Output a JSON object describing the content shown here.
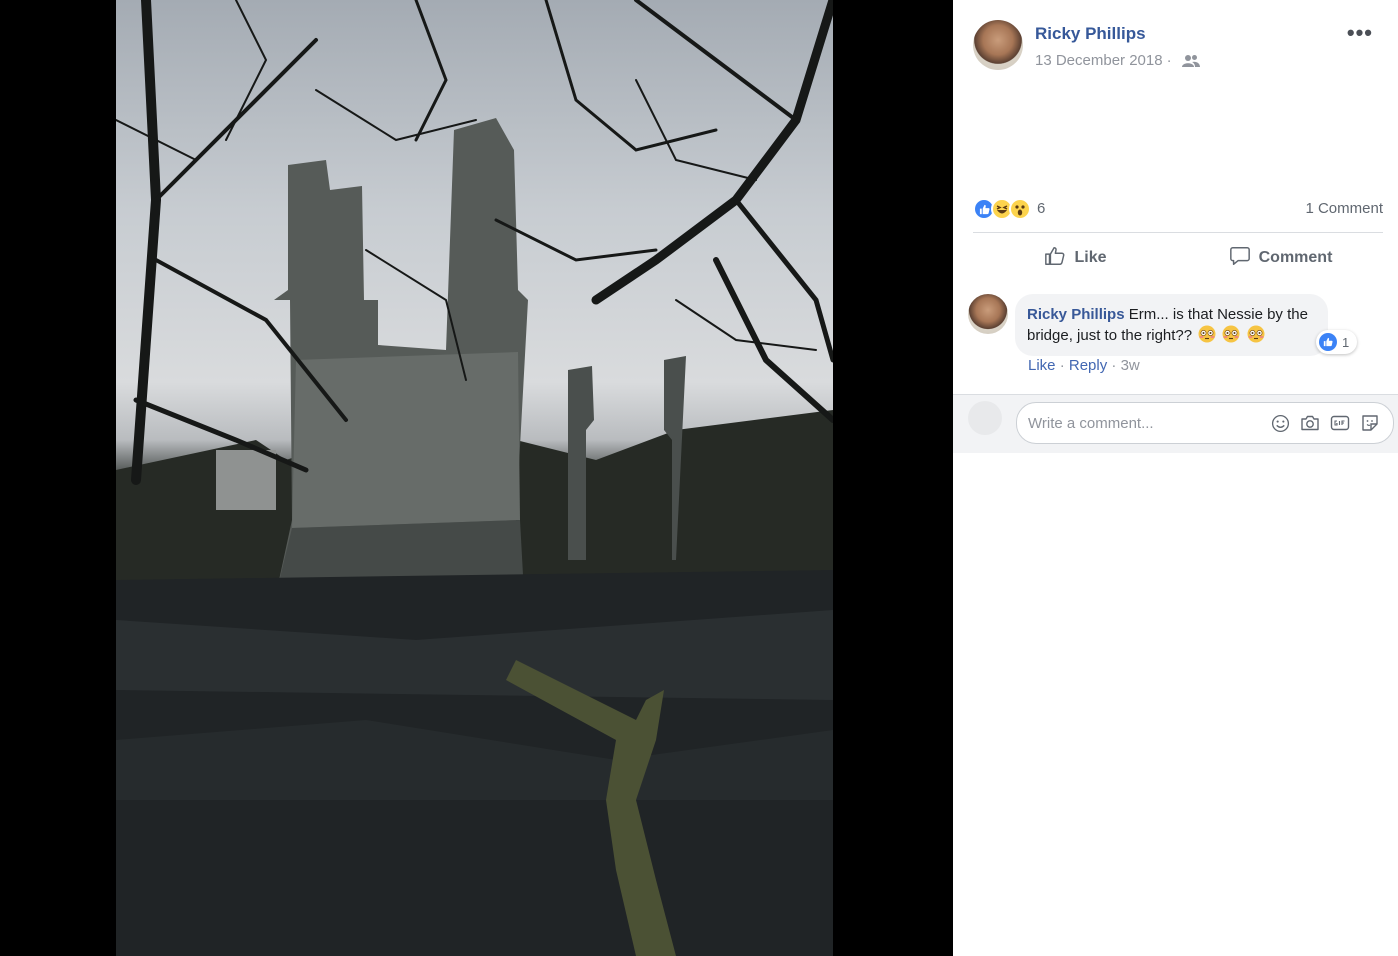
{
  "post": {
    "author": "Ricky Phillips",
    "date": "13 December 2018",
    "date_separator": "·",
    "audience_icon": "friends-icon",
    "more_icon": "more-options-icon",
    "more_glyph": "•••"
  },
  "reactions": {
    "types": [
      "like",
      "haha",
      "wow"
    ],
    "count": "6",
    "comments_count": "1 Comment"
  },
  "actions": {
    "like_label": "Like",
    "comment_label": "Comment"
  },
  "comments": [
    {
      "author": "Ricky Phillips",
      "text": "Erm... is that Nessie by the bridge, just to the right??",
      "emojis": [
        "flushed-face",
        "flushed-face",
        "flushed-face"
      ],
      "reaction_count": "1",
      "like_label": "Like",
      "reply_label": "Reply",
      "sep": "·",
      "time": "3w"
    }
  ],
  "composer": {
    "placeholder": "Write a comment...",
    "icons": [
      "emoji-icon",
      "camera-icon",
      "gif-icon",
      "sticker-icon"
    ]
  },
  "colors": {
    "link_blue": "#365899",
    "like_blue": "#3b82f6",
    "muted": "#90949c"
  }
}
